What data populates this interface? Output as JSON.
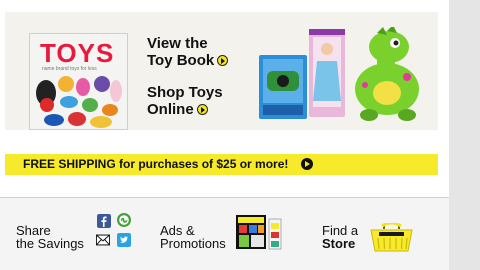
{
  "promo": {
    "toy_book_cover": {
      "title": "TOYS",
      "subtitle": "name brand toys for less"
    },
    "view_toy_book": {
      "line1": "View the",
      "line2": "Toy Book"
    },
    "shop_toys_online": {
      "line1": "Shop Toys",
      "line2": "Online"
    }
  },
  "shipping_banner": {
    "text": "FREE SHIPPING for purchases of $25 or more!"
  },
  "footer": {
    "share": {
      "line1": "Share",
      "line2": "the Savings"
    },
    "ads": {
      "line1": "Ads &",
      "line2": "Promotions"
    },
    "store": {
      "line1": "Find a",
      "line2": "Store"
    }
  },
  "colors": {
    "brand_yellow": "#f6ea2a",
    "toys_red": "#e8193c",
    "facebook": "#3b5998",
    "stumbleupon": "#41a336",
    "twitter": "#2aa3e0"
  },
  "icons": [
    "arrow-right-icon",
    "facebook-icon",
    "stumbleupon-icon",
    "email-icon",
    "twitter-icon",
    "shopping-basket-icon"
  ]
}
